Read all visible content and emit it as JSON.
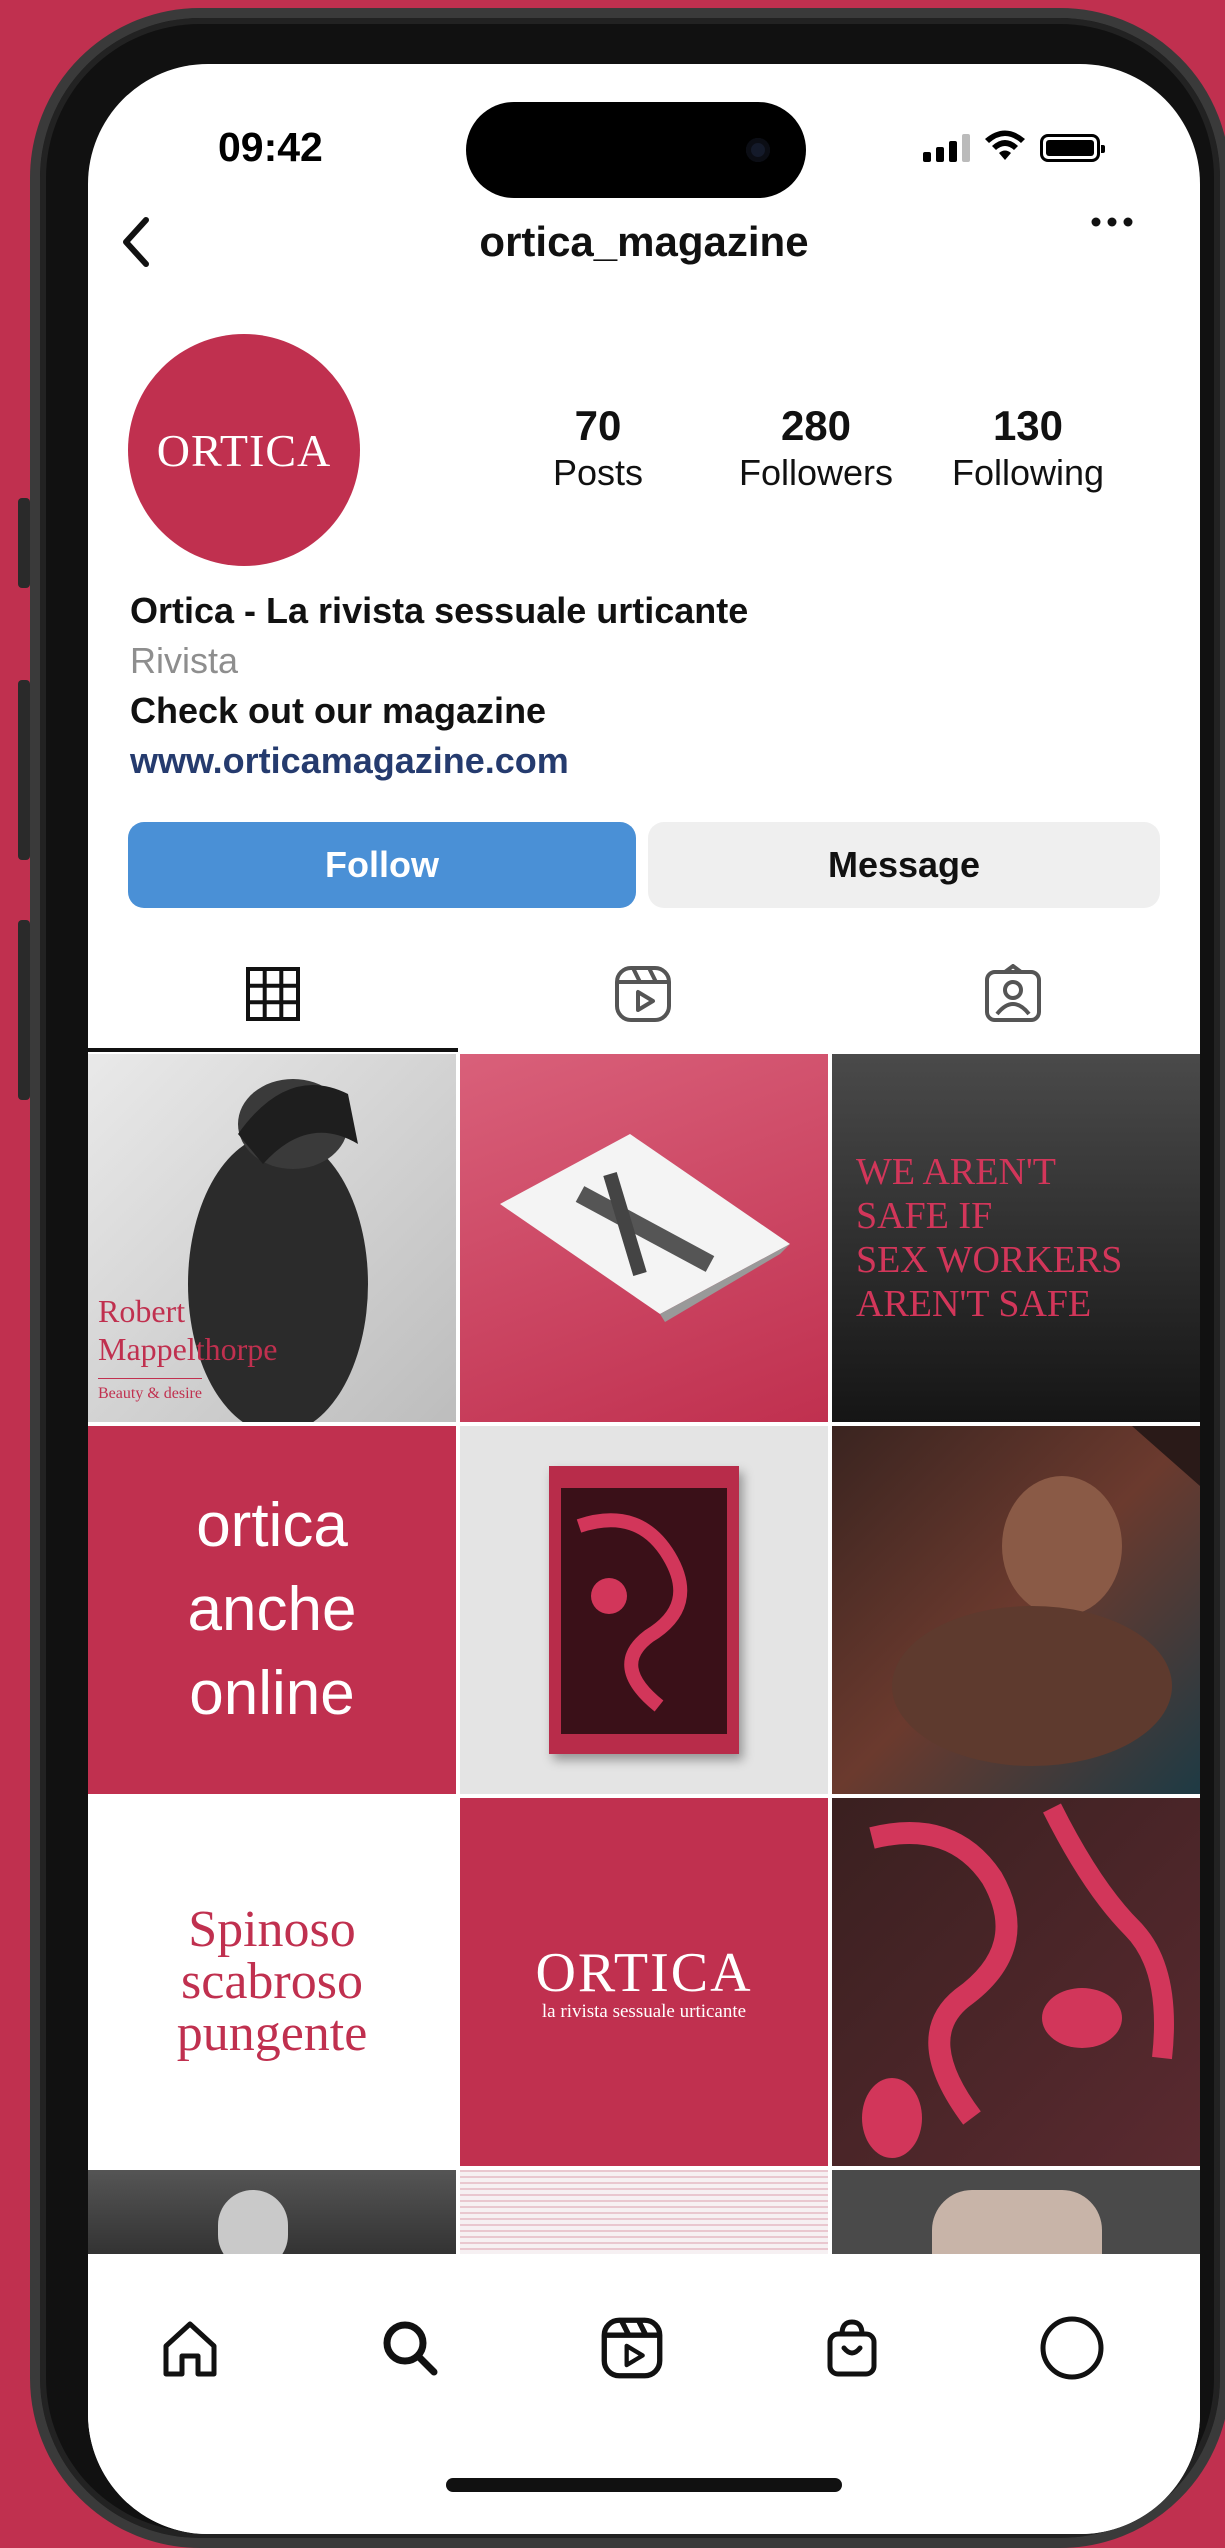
{
  "status_bar": {
    "time": "09:42"
  },
  "header": {
    "back_icon": "chevron-left-icon",
    "username": "ortica_magazine",
    "more_icon": "ellipsis-icon"
  },
  "profile": {
    "avatar_text": "ORTICA",
    "stats": [
      {
        "value": "70",
        "label": "Posts"
      },
      {
        "value": "280",
        "label": "Followers"
      },
      {
        "value": "130",
        "label": "Following"
      }
    ],
    "name": "Ortica - La rivista sessuale urticante",
    "category": "Rivista",
    "bio": "Check out our magazine",
    "link": "www.orticamagazine.com"
  },
  "actions": {
    "follow": "Follow",
    "message": "Message"
  },
  "tabs": [
    {
      "icon": "grid-icon",
      "selected": true
    },
    {
      "icon": "reels-icon",
      "selected": false
    },
    {
      "icon": "tagged-icon",
      "selected": false
    }
  ],
  "posts": {
    "post1": {
      "line1": "Robert",
      "line2": "Mappelthorpe",
      "sub": "Beauty & desire"
    },
    "post3": {
      "line1": "WE AREN'T",
      "line2": "SAFE IF",
      "line3": "SEX WORKERS",
      "line4": "AREN'T SAFE"
    },
    "post4": {
      "line1": "ortica",
      "line2": "anche",
      "line3": "online"
    },
    "post7": {
      "line1": "Spinoso",
      "line2": "scabroso",
      "line3": "pungente"
    },
    "post8": {
      "title": "ORTICA",
      "subtitle": "la rivista sessuale urticante"
    }
  },
  "bottom_nav": [
    "home-icon",
    "search-icon",
    "reels-icon",
    "shop-icon",
    "profile-icon"
  ],
  "colors": {
    "brand": "#c0304f",
    "follow": "#4a90d6",
    "link": "#253b6e"
  }
}
